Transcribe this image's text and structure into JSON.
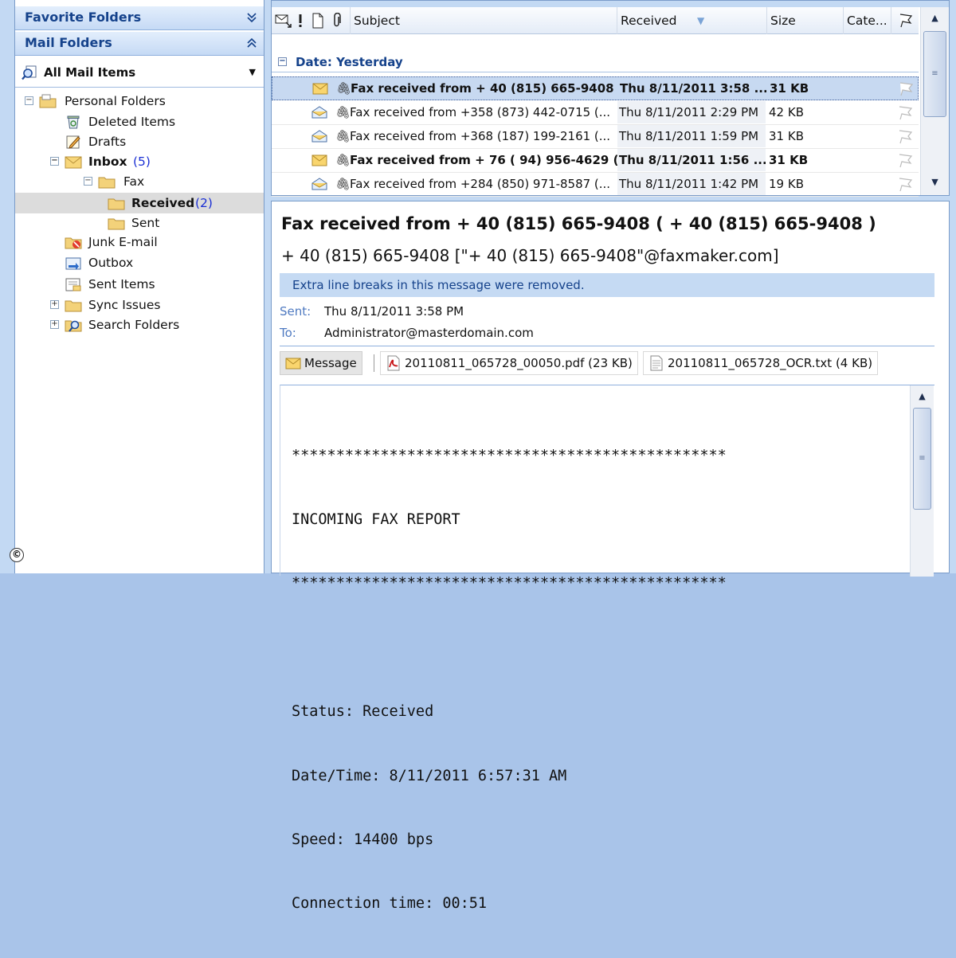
{
  "nav": {
    "favorite_folders": "Favorite Folders",
    "mail_folders": "Mail Folders",
    "all_mail_items": "All Mail Items",
    "tree": {
      "personal_folders": "Personal Folders",
      "deleted_items": "Deleted Items",
      "drafts": "Drafts",
      "inbox": "Inbox",
      "inbox_count": "(5)",
      "fax": "Fax",
      "received": "Received",
      "received_count": "(2)",
      "sent": "Sent",
      "junk": "Junk E-mail",
      "outbox": "Outbox",
      "sent_items": "Sent Items",
      "sync_issues": "Sync Issues",
      "search_folders": "Search Folders"
    }
  },
  "list": {
    "columns": {
      "subject": "Subject",
      "received": "Received",
      "size": "Size",
      "categories": "Cate..."
    },
    "group_label": "Date: Yesterday",
    "messages": [
      {
        "subject": "Fax received from + 40 (815) 665-9408 ...",
        "received": "Thu 8/11/2011 3:58 ...",
        "size": "31 KB"
      },
      {
        "subject": "Fax received from +358 (873) 442-0715 (...",
        "received": "Thu 8/11/2011 2:29 PM",
        "size": "42 KB"
      },
      {
        "subject": "Fax received from +368 (187) 199-2161 (...",
        "received": "Thu 8/11/2011 1:59 PM",
        "size": "31 KB"
      },
      {
        "subject": "Fax received from + 76 ( 94) 956-4629 (...",
        "received": "Thu 8/11/2011 1:56 ...",
        "size": "31 KB"
      },
      {
        "subject": "Fax received from +284 (850) 971-8587 (...",
        "received": "Thu 8/11/2011 1:42 PM",
        "size": "19 KB"
      }
    ]
  },
  "reading": {
    "subject": "Fax received from + 40 (815) 665-9408 ( + 40 (815) 665-9408 )",
    "from": "+ 40 (815) 665-9408 [\"+ 40 (815) 665-9408\"@faxmaker.com]",
    "info_bar": "Extra line breaks in this message were removed.",
    "sent_label": "Sent:",
    "sent_value": "Thu 8/11/2011 3:58 PM",
    "to_label": "To:",
    "to_value": "Administrator@masterdomain.com",
    "attachments": {
      "message": "Message",
      "pdf": "20110811_065728_00050.pdf (23 KB)",
      "txt": "20110811_065728_OCR.txt (4 KB)"
    },
    "body": {
      "stars1": "*************************************************",
      "title": "INCOMING FAX REPORT",
      "stars2": "*************************************************",
      "status": "Status: Received",
      "datetime": "Date/Time: 8/11/2011 6:57:31 AM",
      "speed": "Speed: 14400 bps",
      "connection": "Connection time: 00:51"
    }
  },
  "copyright_symbol": "©",
  "colors": {
    "header_blue": "#15428b",
    "selection": "#c7d9f1",
    "info_bar": "#c5daf3",
    "count_blue": "#1a2fd4"
  }
}
